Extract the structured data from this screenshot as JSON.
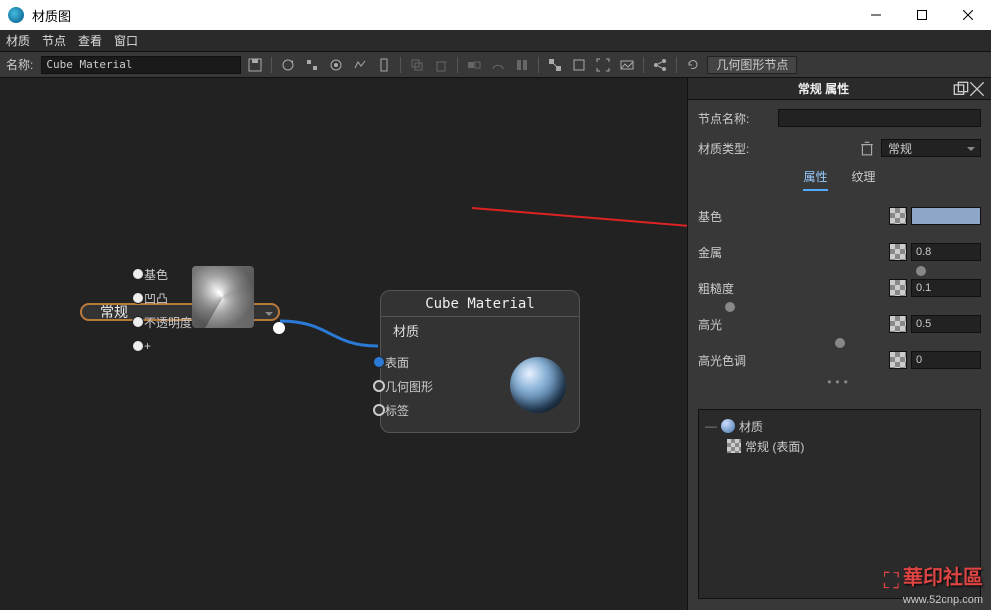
{
  "window": {
    "title": "材质图"
  },
  "menu": {
    "items": [
      "材质",
      "节点",
      "查看",
      "窗口"
    ]
  },
  "toolbar": {
    "name_label": "名称:",
    "name_value": "Cube Material",
    "geo_btn": "几何图形节点"
  },
  "nodes": {
    "generic": {
      "title": "常规",
      "ports": [
        "基色",
        "凹凸",
        "不透明度",
        "+"
      ]
    },
    "material": {
      "header": "Cube Material",
      "title": "材质",
      "ports": [
        "表面",
        "几何图形",
        "标签"
      ]
    }
  },
  "panel": {
    "title": "常规  属性",
    "node_name_label": "节点名称:",
    "node_name_value": "",
    "mat_type_label": "材质类型:",
    "mat_type_value": "常规",
    "tabs": {
      "attrs": "属性",
      "tex": "纹理"
    },
    "props": {
      "base": {
        "label": "基色",
        "color": "#8ea6c8"
      },
      "metal": {
        "label": "金属",
        "value": "0.8"
      },
      "rough": {
        "label": "粗糙度",
        "value": "0.1"
      },
      "spec": {
        "label": "高光",
        "value": "0.5"
      },
      "spectint": {
        "label": "高光色调",
        "value": "0"
      }
    },
    "tree": {
      "root": "材质",
      "child": "常规 (表面)"
    }
  },
  "watermark": {
    "brand": "華印社區",
    "url": "www.52cnp.com"
  }
}
